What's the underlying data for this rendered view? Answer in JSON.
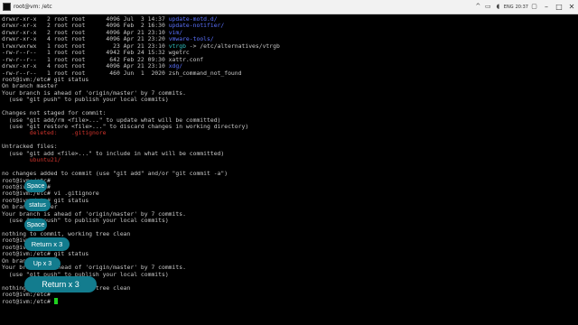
{
  "window": {
    "title": "root@vm: /etc",
    "keyboard_layout": "ENG",
    "clock": "20:37"
  },
  "terminal": {
    "lines": [
      {
        "segments": [
          {
            "t": "drwxr-xr-x   2 root root      4096 Jul  3 14:37 ",
            "c": "plain"
          },
          {
            "t": "update-motd.d/",
            "c": "dir"
          }
        ]
      },
      {
        "segments": [
          {
            "t": "drwxr-xr-x   2 root root      4096 Feb  2 16:30 ",
            "c": "plain"
          },
          {
            "t": "update-notifier/",
            "c": "dir"
          }
        ]
      },
      {
        "segments": [
          {
            "t": "drwxr-xr-x   2 root root      4096 Apr 21 23:10 ",
            "c": "plain"
          },
          {
            "t": "vim/",
            "c": "dir"
          }
        ]
      },
      {
        "segments": [
          {
            "t": "drwxr-xr-x   4 root root      4096 Apr 21 23:20 ",
            "c": "plain"
          },
          {
            "t": "vmware-tools/",
            "c": "dir"
          }
        ]
      },
      {
        "segments": [
          {
            "t": "lrwxrwxrwx   1 root root        23 Apr 21 23:10 ",
            "c": "plain"
          },
          {
            "t": "vtrgb",
            "c": "cyan"
          },
          {
            "t": " -> /etc/alternatives/vtrgb",
            "c": "plain"
          }
        ]
      },
      {
        "segments": [
          {
            "t": "-rw-r--r--   1 root root      4942 Feb 24 15:32 wgetrc",
            "c": "plain"
          }
        ]
      },
      {
        "segments": [
          {
            "t": "-rw-r--r--   1 root root       642 Feb 22 09:30 xattr.conf",
            "c": "plain"
          }
        ]
      },
      {
        "segments": [
          {
            "t": "drwxr-xr-x   4 root root      4096 Apr 21 23:10 ",
            "c": "plain"
          },
          {
            "t": "xdg/",
            "c": "dir"
          }
        ]
      },
      {
        "segments": [
          {
            "t": "-rw-r--r--   1 root root       460 Jun  1  2020 zsh_command_not_found",
            "c": "plain"
          }
        ]
      },
      {
        "segments": [
          {
            "t": "root@ivm:/etc# git status",
            "c": "plain"
          }
        ]
      },
      {
        "segments": [
          {
            "t": "On branch master",
            "c": "plain"
          }
        ]
      },
      {
        "segments": [
          {
            "t": "Your branch is ahead of 'origin/master' by 7 commits.",
            "c": "plain"
          }
        ]
      },
      {
        "segments": [
          {
            "t": "  (use \"git push\" to publish your local commits)",
            "c": "plain"
          }
        ]
      },
      {
        "segments": [
          {
            "t": "",
            "c": "plain"
          }
        ]
      },
      {
        "segments": [
          {
            "t": "Changes not staged for commit:",
            "c": "plain"
          }
        ]
      },
      {
        "segments": [
          {
            "t": "  (use \"git add/rm <file>...\" to update what will be committed)",
            "c": "plain"
          }
        ]
      },
      {
        "segments": [
          {
            "t": "  (use \"git restore <file>...\" to discard changes in working directory)",
            "c": "plain"
          }
        ]
      },
      {
        "segments": [
          {
            "t": "        deleted:    .gitignore",
            "c": "red"
          }
        ]
      },
      {
        "segments": [
          {
            "t": "",
            "c": "plain"
          }
        ]
      },
      {
        "segments": [
          {
            "t": "Untracked files:",
            "c": "plain"
          }
        ]
      },
      {
        "segments": [
          {
            "t": "  (use \"git add <file>...\" to include in what will be committed)",
            "c": "plain"
          }
        ]
      },
      {
        "segments": [
          {
            "t": "        ubuntu21/",
            "c": "red"
          }
        ]
      },
      {
        "segments": [
          {
            "t": "",
            "c": "plain"
          }
        ]
      },
      {
        "segments": [
          {
            "t": "no changes added to commit (use \"git add\" and/or \"git commit -a\")",
            "c": "plain"
          }
        ]
      },
      {
        "segments": [
          {
            "t": "root@ivm:/etc#",
            "c": "plain"
          }
        ]
      },
      {
        "segments": [
          {
            "t": "root@ivm:/etc#",
            "c": "plain"
          }
        ]
      },
      {
        "segments": [
          {
            "t": "root@ivm:/etc# vi .gitignore",
            "c": "plain"
          }
        ]
      },
      {
        "segments": [
          {
            "t": "root@ivm:/etc# git status",
            "c": "plain"
          }
        ]
      },
      {
        "segments": [
          {
            "t": "On branch master",
            "c": "plain"
          }
        ]
      },
      {
        "segments": [
          {
            "t": "Your branch is ahead of 'origin/master' by 7 commits.",
            "c": "plain"
          }
        ]
      },
      {
        "segments": [
          {
            "t": "  (use \"git push\" to publish your local commits)",
            "c": "plain"
          }
        ]
      },
      {
        "segments": [
          {
            "t": "",
            "c": "plain"
          }
        ]
      },
      {
        "segments": [
          {
            "t": "nothing to commit, working tree clean",
            "c": "plain"
          }
        ]
      },
      {
        "segments": [
          {
            "t": "root@ivm:/etc#",
            "c": "plain"
          }
        ]
      },
      {
        "segments": [
          {
            "t": "root@ivm:/etc#",
            "c": "plain"
          }
        ]
      },
      {
        "segments": [
          {
            "t": "root@ivm:/etc# git status",
            "c": "plain"
          }
        ]
      },
      {
        "segments": [
          {
            "t": "On branch master",
            "c": "plain"
          }
        ]
      },
      {
        "segments": [
          {
            "t": "Your branch is ahead of 'origin/master' by 7 commits.",
            "c": "plain"
          }
        ]
      },
      {
        "segments": [
          {
            "t": "  (use \"git push\" to publish your local commits)",
            "c": "plain"
          }
        ]
      },
      {
        "segments": [
          {
            "t": "",
            "c": "plain"
          }
        ]
      },
      {
        "segments": [
          {
            "t": "nothing to commit, working tree clean",
            "c": "plain"
          }
        ]
      },
      {
        "segments": [
          {
            "t": "root@ivm:/etc#",
            "c": "plain"
          }
        ]
      },
      {
        "segments": [
          {
            "t": "root@ivm:/etc# ",
            "c": "plain"
          },
          {
            "t": "",
            "c": "cursor"
          }
        ]
      }
    ]
  },
  "key_overlays": [
    {
      "label": "Space"
    },
    {
      "label": "status"
    },
    {
      "label": "Space"
    },
    {
      "label": "Return x 3"
    },
    {
      "label": "Up x 3"
    },
    {
      "label": "Return x 3"
    }
  ],
  "colors": {
    "background": "#000000",
    "text": "#c8c8c8",
    "directory": "#5b72ff",
    "symlink": "#2fc3c3",
    "git_red": "#d0342c",
    "cursor": "#1fd11f",
    "badge": "#137c8e"
  }
}
